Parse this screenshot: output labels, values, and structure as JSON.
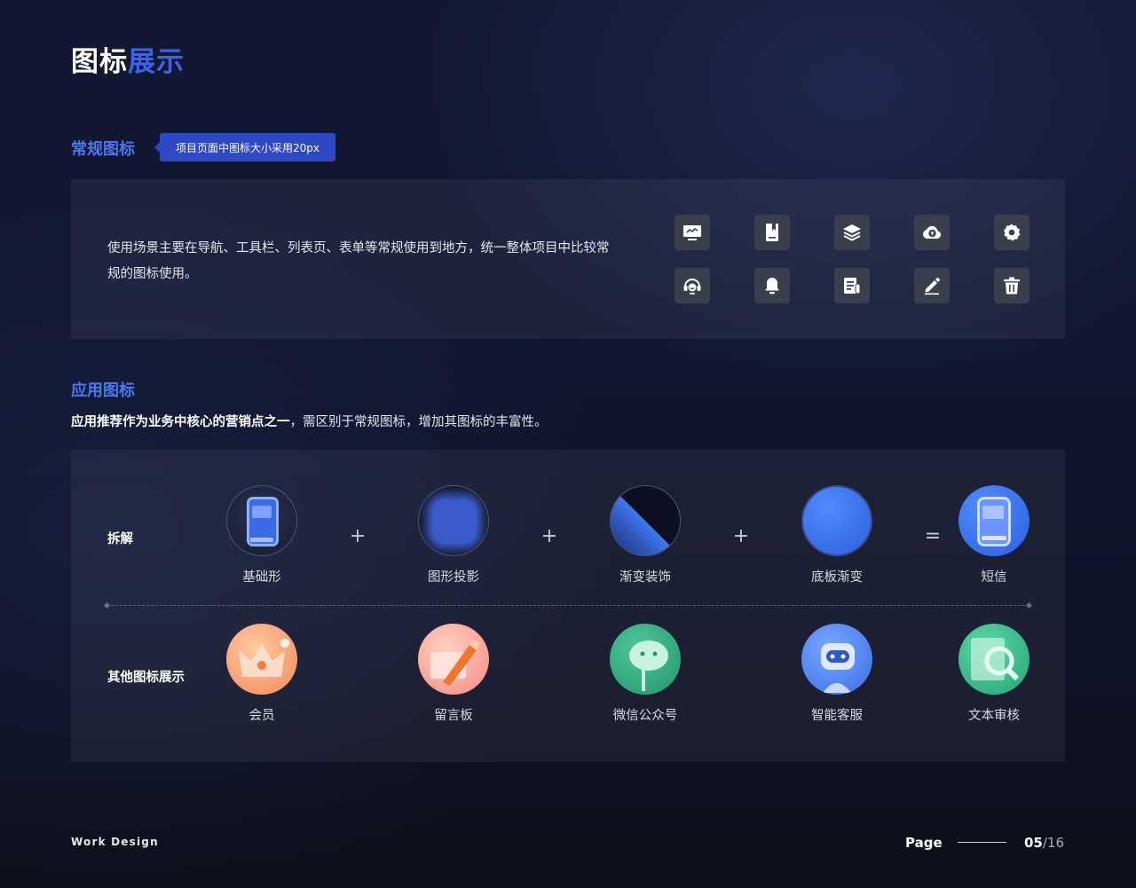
{
  "header": {
    "title_white": "图标",
    "title_blue": "展示"
  },
  "regular": {
    "heading": "常规图标",
    "tag": "项目页面中图标大小采用20px",
    "description": "使用场景主要在导航、工具栏、列表页、表单等常规使用到地方，统一整体项目中比较常规的图标使用。",
    "icons": [
      "monitor-chart-icon",
      "bookmark-icon",
      "layers-icon",
      "cloud-upload-icon",
      "settings-icon",
      "headset-support-icon",
      "bell-icon",
      "document-icon",
      "edit-pencil-icon",
      "trash-icon"
    ]
  },
  "app": {
    "heading": "应用图标",
    "subtitle_bold": "应用推荐作为业务中核心的营销点之一",
    "subtitle_rest": "，需区别于常规图标，增加其图标的丰富性。",
    "breakdown_label": "拆解",
    "breakdown": [
      "基础形",
      "图形投影",
      "渐变装饰",
      "底板渐变",
      "短信"
    ],
    "operators": [
      "+",
      "+",
      "+",
      "="
    ],
    "others_label": "其他图标展示",
    "others": [
      "会员",
      "留言板",
      "微信公众号",
      "智能客服",
      "文本审核"
    ]
  },
  "footer": {
    "brand": "Work Design",
    "page_label": "Page",
    "page_current": "05",
    "page_total": "/16"
  },
  "colors": {
    "accent": "#3b63e8",
    "tag_bg": "#2f48c8",
    "heading_blue": "#4a78ee"
  }
}
